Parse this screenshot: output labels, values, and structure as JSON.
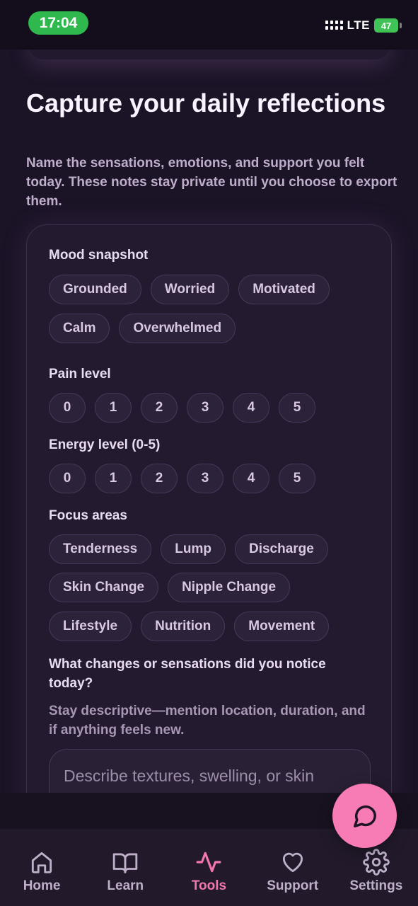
{
  "status": {
    "time": "17:04",
    "network": "LTE",
    "battery": "47"
  },
  "page": {
    "headline": "Capture your daily reflections",
    "subtext": "Name the sensations, emotions, and support you felt today. These notes stay private until you choose to export them."
  },
  "mood": {
    "label": "Mood snapshot",
    "options": [
      "Grounded",
      "Worried",
      "Motivated",
      "Calm",
      "Overwhelmed"
    ]
  },
  "pain": {
    "label": "Pain level",
    "options": [
      "0",
      "1",
      "2",
      "3",
      "4",
      "5"
    ]
  },
  "energy": {
    "label": "Energy level (0-5)",
    "options": [
      "0",
      "1",
      "2",
      "3",
      "4",
      "5"
    ]
  },
  "focus": {
    "label": "Focus areas",
    "options": [
      "Tenderness",
      "Lump",
      "Discharge",
      "Skin Change",
      "Nipple Change",
      "Lifestyle",
      "Nutrition",
      "Movement"
    ]
  },
  "notes": {
    "question": "What changes or sensations did you notice today?",
    "hint": "Stay descriptive—mention location, duration, and if anything feels new.",
    "placeholder": "Describe textures, swelling, or skin"
  },
  "fab": {
    "icon": "chat-bubble-icon"
  },
  "nav": {
    "items": [
      {
        "label": "Home",
        "icon": "home-icon"
      },
      {
        "label": "Learn",
        "icon": "book-icon"
      },
      {
        "label": "Tools",
        "icon": "activity-icon"
      },
      {
        "label": "Support",
        "icon": "heart-icon"
      },
      {
        "label": "Settings",
        "icon": "gear-icon"
      }
    ],
    "active": "Tools"
  },
  "colors": {
    "accent": "#f277ad",
    "fab": "#f77bb4",
    "background": "#1b1326",
    "card": "#231a2f"
  }
}
